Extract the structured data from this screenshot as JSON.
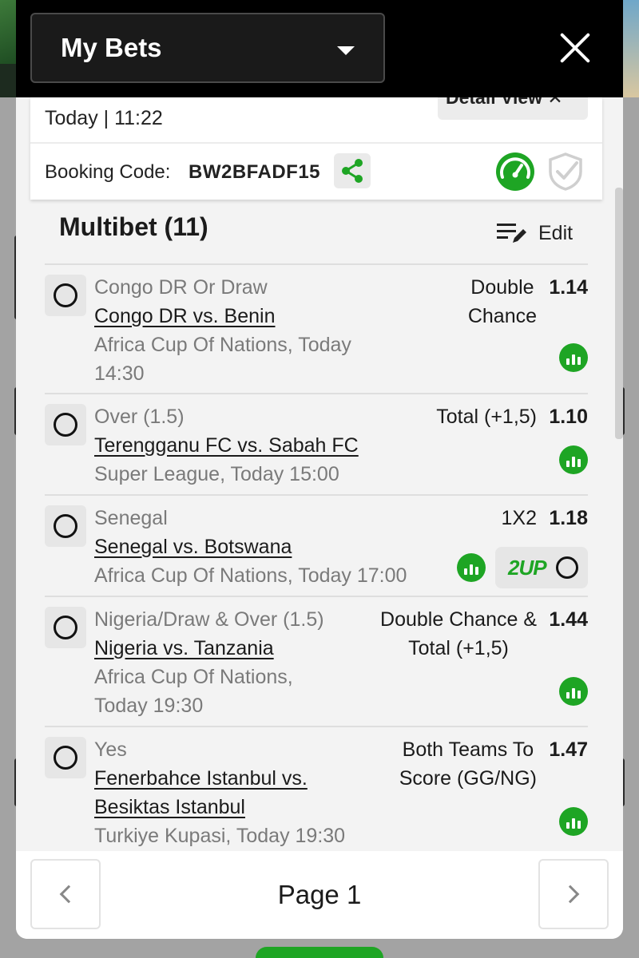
{
  "header": {
    "title": "My Bets"
  },
  "ticket": {
    "date": "Today | 11:22",
    "detail_view_label": "Detail View ✕",
    "booking_label": "Booking Code:",
    "booking_code": "BW2BFADF15"
  },
  "multibet": {
    "title": "Multibet (11)",
    "edit_label": "Edit"
  },
  "bets": [
    {
      "pick": "Congo DR Or Draw",
      "match": "Congo DR vs. Benin",
      "competition_line1": "Africa Cup Of Nations, Today",
      "competition_line2": "14:30",
      "market_line1": "Double",
      "market_line2": "Chance",
      "odds": "1.14"
    },
    {
      "pick": "Over (1.5)",
      "match": "Terengganu FC vs. Sabah FC",
      "competition_line1": "Super League, Today 15:00",
      "market_line1": "Total (+1,5)",
      "odds": "1.10"
    },
    {
      "pick": "Senegal",
      "match": "Senegal vs. Botswana",
      "competition_line1": "Africa Cup Of Nations, Today 17:00",
      "market_line1": "1X2",
      "odds": "1.18",
      "badge": "2UP"
    },
    {
      "pick": "Nigeria/Draw & Over (1.5)",
      "match": "Nigeria vs. Tanzania",
      "competition_line1": "Africa Cup Of Nations,",
      "competition_line2": "Today 19:30",
      "market_line1": "Double Chance &",
      "market_line2": "Total (+1,5)",
      "odds": "1.44"
    },
    {
      "pick": "Yes",
      "match_line1": "Fenerbahce Istanbul vs.",
      "match_line2": "Besiktas Istanbul",
      "competition_line1": "Turkiye Kupasi, Today 19:30",
      "market_line1": "Both Teams To",
      "market_line2": "Score (GG/NG)",
      "odds": "1.47"
    }
  ],
  "pager": {
    "label": "Page 1"
  },
  "colors": {
    "accent_green": "#1ea524",
    "header_bg": "#000000"
  },
  "icons": [
    "chevron-down-icon",
    "close-icon",
    "share-icon",
    "gauge-icon",
    "shield-check-icon",
    "edit-list-icon",
    "stats-icon",
    "radio-icon",
    "chevron-left-icon",
    "chevron-right-icon"
  ]
}
